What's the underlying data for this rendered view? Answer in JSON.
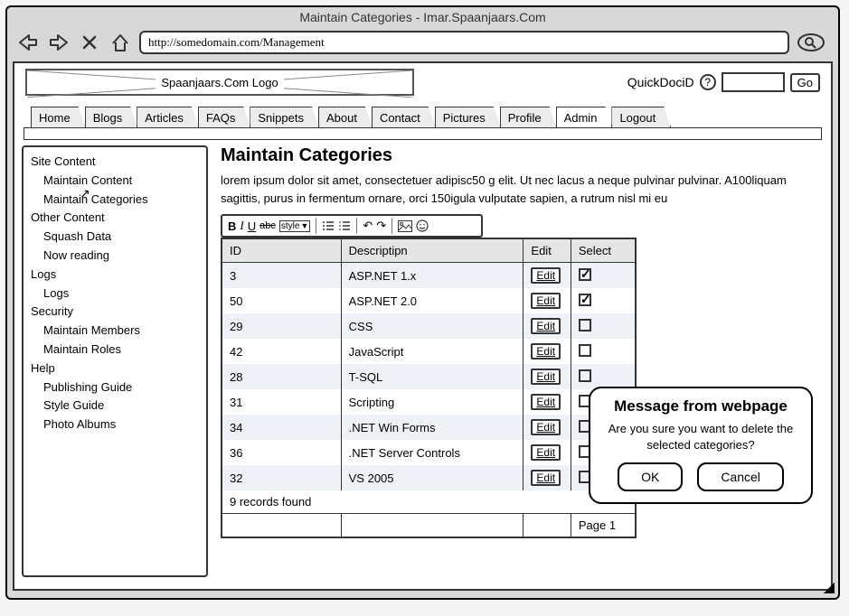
{
  "browser": {
    "title": "Maintain Categories - Imar.Spaanjaars.Com",
    "url": "http://somedomain.com/Management"
  },
  "header": {
    "logo_text": "Spaanjaars.Com Logo",
    "quickdoc_label": "QuickDociD",
    "go_label": "Go"
  },
  "tabs": [
    "Home",
    "Blogs",
    "Articles",
    "FAQs",
    "Snippets",
    "About",
    "Contact",
    "Pictures",
    "Profile",
    "Admin",
    "Logout"
  ],
  "active_tab": "Admin",
  "sidebar": [
    {
      "type": "header",
      "label": "Site Content"
    },
    {
      "type": "item",
      "label": "Maintain Content"
    },
    {
      "type": "item",
      "label": "Maintain Categories"
    },
    {
      "type": "header",
      "label": "Other Content"
    },
    {
      "type": "item",
      "label": "Squash Data"
    },
    {
      "type": "item",
      "label": "Now reading"
    },
    {
      "type": "header",
      "label": "Logs"
    },
    {
      "type": "item",
      "label": "Logs"
    },
    {
      "type": "header",
      "label": "Security"
    },
    {
      "type": "item",
      "label": "Maintain Members"
    },
    {
      "type": "item",
      "label": "Maintain Roles"
    },
    {
      "type": "header",
      "label": "Help"
    },
    {
      "type": "item",
      "label": "Publishing Guide"
    },
    {
      "type": "item",
      "label": "Style Guide"
    },
    {
      "type": "item",
      "label": "Photo Albums"
    }
  ],
  "main": {
    "heading": "Maintain Categories",
    "description": "lorem ipsum dolor sit amet, consectetuer adipisc50 g elit. Ut nec lacus a neque pulvinar pulvinar. A100liquam sagittis, purus in fermentum ornare, orci 150igula vulputate sapien, a rutrum nisl mi eu",
    "toolbar_style_label": "style",
    "columns": [
      "ID",
      "Descriptipn",
      "Edit",
      "Select"
    ],
    "edit_label": "Edit",
    "rows": [
      {
        "id": "3",
        "desc": "ASP.NET 1.x",
        "checked": true
      },
      {
        "id": "50",
        "desc": "ASP.NET 2.0",
        "checked": true
      },
      {
        "id": "29",
        "desc": "CSS",
        "checked": false
      },
      {
        "id": "42",
        "desc": "JavaScript",
        "checked": false
      },
      {
        "id": "28",
        "desc": "T-SQL",
        "checked": false
      },
      {
        "id": "31",
        "desc": "Scripting",
        "checked": false
      },
      {
        "id": "34",
        "desc": ".NET Win Forms",
        "checked": false
      },
      {
        "id": "36",
        "desc": ".NET Server Controls",
        "checked": false
      },
      {
        "id": "32",
        "desc": "VS 2005",
        "checked": false
      }
    ],
    "records_found": "9 records found",
    "page_label": "Page 1"
  },
  "dialog": {
    "title": "Message from webpage",
    "text": "Are you sure you want to delete the selected categories?",
    "ok": "OK",
    "cancel": "Cancel"
  }
}
